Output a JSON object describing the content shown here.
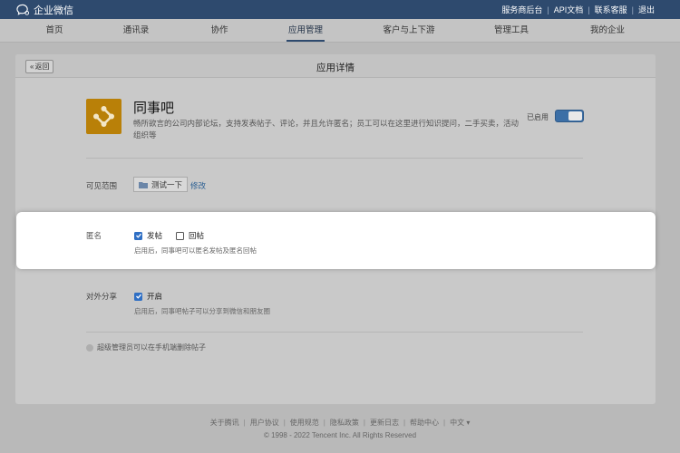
{
  "topbar": {
    "brand": "企业微信",
    "links": [
      "服务商后台",
      "API文档",
      "联系客服",
      "退出"
    ]
  },
  "nav": {
    "items": [
      "首页",
      "通讯录",
      "协作",
      "应用管理",
      "客户与上下游",
      "管理工具",
      "我的企业"
    ],
    "active": "应用管理"
  },
  "panel": {
    "back_label": "返回",
    "title": "应用详情"
  },
  "app": {
    "name": "同事吧",
    "description": "畅所欲言的公司内部论坛，支持发表帖子、评论，并且允许匿名；员工可以在这里进行知识提问，二手买卖，活动组织等",
    "status_label": "已启用",
    "enabled": true
  },
  "visibility": {
    "label": "可见范围",
    "tag": "测试一下",
    "edit_link": "修改"
  },
  "anonymous": {
    "label": "匿名",
    "options": [
      {
        "label": "发帖",
        "checked": true
      },
      {
        "label": "回帖",
        "checked": false
      }
    ],
    "hint": "启用后，同事吧可以匿名发帖及匿名回帖"
  },
  "share": {
    "label": "对外分享",
    "option": {
      "label": "开启",
      "checked": true
    },
    "hint": "启用后，同事吧帖子可以分享到微信和朋友圈"
  },
  "admin_option": {
    "label": "超级管理员可以在手机端删除帖子",
    "selected": false
  },
  "footer": {
    "links": [
      "关于腾讯",
      "用户协议",
      "使用规范",
      "隐私政策",
      "更新日志",
      "帮助中心",
      "中文"
    ],
    "copyright": "© 1998 - 2022 Tencent Inc. All Rights Reserved"
  },
  "colors": {
    "topbar": "#2e4a6e",
    "accent": "#2f6fc4",
    "app_icon": "#b98008"
  }
}
